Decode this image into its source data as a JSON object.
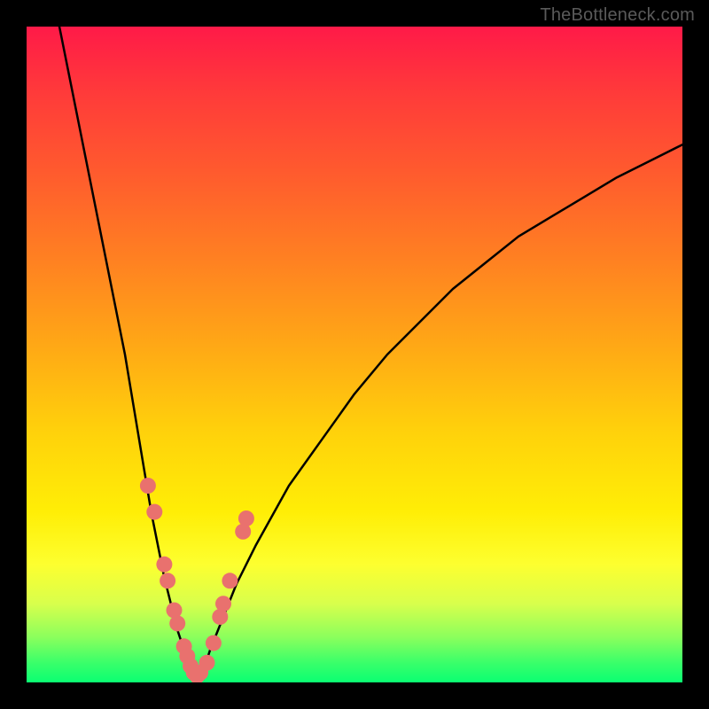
{
  "watermark": "TheBottleneck.com",
  "chart_data": {
    "type": "line",
    "title": "",
    "xlabel": "",
    "ylabel": "",
    "xlim": [
      0,
      100
    ],
    "ylim": [
      0,
      100
    ],
    "grid": false,
    "legend": false,
    "series": [
      {
        "name": "curve-left",
        "color": "#000000",
        "x": [
          5,
          7,
          9,
          11,
          13,
          15,
          16,
          17,
          18,
          19,
          20,
          21,
          22,
          23,
          24,
          25,
          26
        ],
        "y": [
          100,
          90,
          80,
          70,
          60,
          50,
          44,
          38,
          32,
          26,
          21,
          16,
          12,
          8,
          5,
          2,
          0
        ]
      },
      {
        "name": "curve-right",
        "color": "#000000",
        "x": [
          26,
          27,
          28,
          30,
          32,
          35,
          40,
          45,
          50,
          55,
          60,
          65,
          70,
          75,
          80,
          85,
          90,
          95,
          100
        ],
        "y": [
          0,
          2,
          5,
          10,
          15,
          21,
          30,
          37,
          44,
          50,
          55,
          60,
          64,
          68,
          71,
          74,
          77,
          79.5,
          82
        ]
      },
      {
        "name": "marker-dots",
        "type": "scatter",
        "color": "#e9716e",
        "x": [
          18.5,
          19.5,
          21.0,
          21.5,
          22.5,
          23.0,
          24.0,
          24.5,
          25.0,
          25.5,
          26.0,
          26.5,
          27.5,
          28.5,
          29.5,
          30.0,
          31.0,
          33.0,
          33.5
        ],
        "y": [
          30.0,
          26.0,
          18.0,
          15.5,
          11.0,
          9.0,
          5.5,
          4.0,
          2.5,
          1.5,
          1.0,
          1.5,
          3.0,
          6.0,
          10.0,
          12.0,
          15.5,
          23.0,
          25.0
        ]
      }
    ]
  }
}
